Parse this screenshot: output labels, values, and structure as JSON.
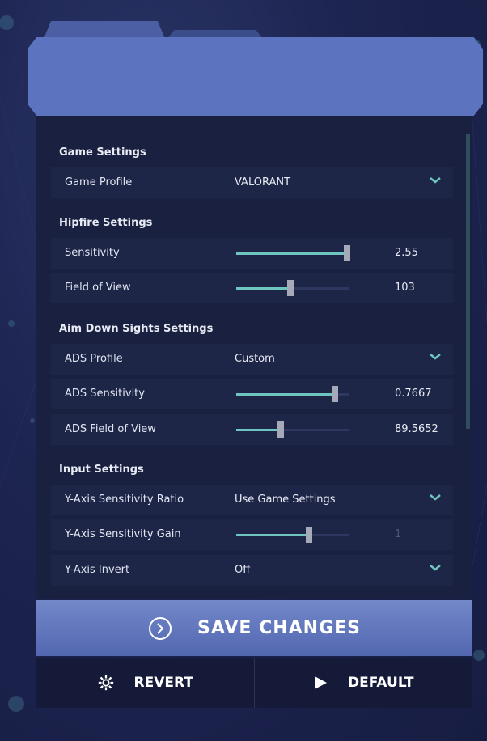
{
  "colors": {
    "accent": "#6fc6c0",
    "header": "#5c73bf",
    "panel": "#1a2140",
    "row": "#1e2648"
  },
  "sections": {
    "game": "Game Settings",
    "hipfire": "Hipfire Settings",
    "ads": "Aim Down Sights Settings",
    "input": "Input Settings"
  },
  "game": {
    "profile_label": "Game Profile",
    "profile_value": "VALORANT"
  },
  "hipfire": {
    "sensitivity_label": "Sensitivity",
    "sensitivity_value": "2.55",
    "sensitivity_level": 0.98,
    "fov_label": "Field of View",
    "fov_value": "103",
    "fov_level": 0.48
  },
  "ads": {
    "profile_label": "ADS Profile",
    "profile_value": "Custom",
    "sensitivity_label": "ADS Sensitivity",
    "sensitivity_value": "0.7667",
    "sensitivity_level": 0.87,
    "fov_label": "ADS Field of View",
    "fov_value": "89.5652",
    "fov_level": 0.39
  },
  "input": {
    "ratio_label": "Y-Axis Sensitivity Ratio",
    "ratio_value": "Use Game Settings",
    "gain_label": "Y-Axis Sensitivity Gain",
    "gain_value": "1",
    "gain_level": 0.64,
    "invert_label": "Y-Axis Invert",
    "invert_value": "Off"
  },
  "actions": {
    "save": "SAVE CHANGES",
    "revert": "REVERT",
    "default": "DEFAULT"
  },
  "icons": {
    "dropdown": "chevron-down-icon",
    "save": "circle-chevron-right-icon",
    "revert": "gear-icon",
    "default": "play-icon"
  }
}
